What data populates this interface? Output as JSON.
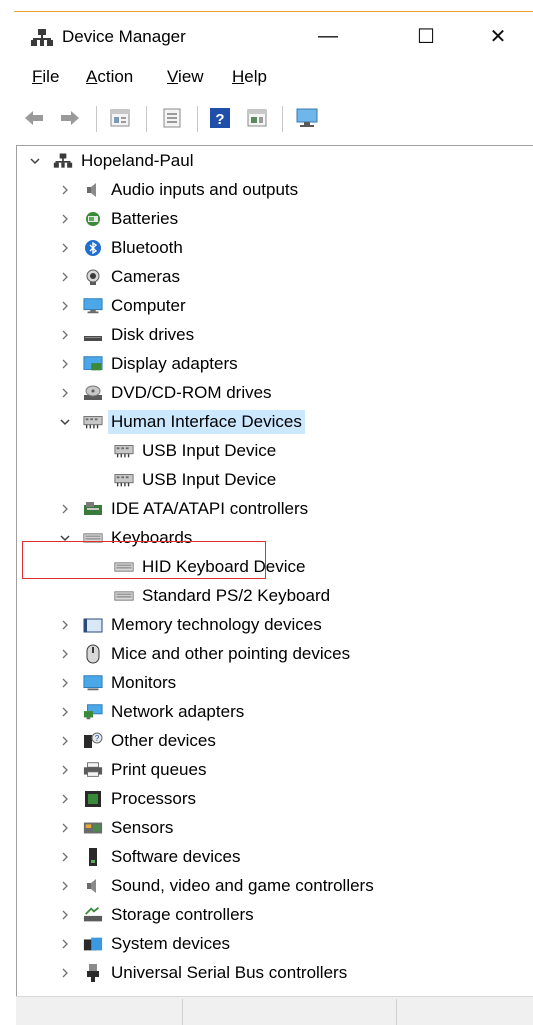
{
  "window": {
    "title": "Device Manager",
    "minimize_glyph": "—",
    "maximize_glyph": "☐",
    "close_glyph": "✕"
  },
  "menu": [
    {
      "accel": "F",
      "rest": "ile"
    },
    {
      "accel": "A",
      "rest": "ction"
    },
    {
      "accel": "V",
      "rest": "iew"
    },
    {
      "accel": "H",
      "rest": "elp"
    }
  ],
  "toolbar": [
    "back-icon",
    "forward-icon",
    "properties-icon",
    "update-driver-icon",
    "help-icon",
    "action-pane-icon",
    "monitor-icon"
  ],
  "tree": {
    "root": "Hopeland-Paul",
    "items": [
      {
        "label": "Audio inputs and outputs",
        "icon": "speaker-icon",
        "expanded": false
      },
      {
        "label": "Batteries",
        "icon": "battery-icon",
        "expanded": false
      },
      {
        "label": "Bluetooth",
        "icon": "bluetooth-icon",
        "expanded": false
      },
      {
        "label": "Cameras",
        "icon": "camera-icon",
        "expanded": false
      },
      {
        "label": "Computer",
        "icon": "computer-icon",
        "expanded": false
      },
      {
        "label": "Disk drives",
        "icon": "disk-drive-icon",
        "expanded": false
      },
      {
        "label": "Display adapters",
        "icon": "display-adapter-icon",
        "expanded": false
      },
      {
        "label": "DVD/CD-ROM drives",
        "icon": "dvd-drive-icon",
        "expanded": false
      },
      {
        "label": "Human Interface Devices",
        "icon": "hid-icon",
        "expanded": true,
        "selected": true,
        "children": [
          {
            "label": "USB Input Device",
            "icon": "hid-icon"
          },
          {
            "label": "USB Input Device",
            "icon": "hid-icon"
          }
        ]
      },
      {
        "label": "IDE ATA/ATAPI controllers",
        "icon": "ide-controller-icon",
        "expanded": false
      },
      {
        "label": "Keyboards",
        "icon": "keyboard-icon",
        "expanded": true,
        "children": [
          {
            "label": "HID Keyboard Device",
            "icon": "keyboard-icon"
          },
          {
            "label": "Standard PS/2 Keyboard",
            "icon": "keyboard-icon"
          }
        ]
      },
      {
        "label": "Memory technology devices",
        "icon": "memory-icon",
        "expanded": false
      },
      {
        "label": "Mice and other pointing devices",
        "icon": "mouse-icon",
        "expanded": false
      },
      {
        "label": "Monitors",
        "icon": "monitor-icon",
        "expanded": false
      },
      {
        "label": "Network adapters",
        "icon": "network-icon",
        "expanded": false
      },
      {
        "label": "Other devices",
        "icon": "unknown-device-icon",
        "expanded": false
      },
      {
        "label": "Print queues",
        "icon": "printer-icon",
        "expanded": false
      },
      {
        "label": "Processors",
        "icon": "processor-icon",
        "expanded": false
      },
      {
        "label": "Sensors",
        "icon": "sensor-icon",
        "expanded": false
      },
      {
        "label": "Software devices",
        "icon": "software-device-icon",
        "expanded": false
      },
      {
        "label": "Sound, video and game controllers",
        "icon": "speaker-icon",
        "expanded": false
      },
      {
        "label": "Storage controllers",
        "icon": "storage-controller-icon",
        "expanded": false
      },
      {
        "label": "System devices",
        "icon": "system-folder-icon",
        "expanded": false
      },
      {
        "label": "Universal Serial Bus controllers",
        "icon": "usb-icon",
        "expanded": false
      }
    ]
  },
  "colors": {
    "selection": "#cce8ff",
    "annotation": "#e03030",
    "accent": "#f0a030"
  }
}
